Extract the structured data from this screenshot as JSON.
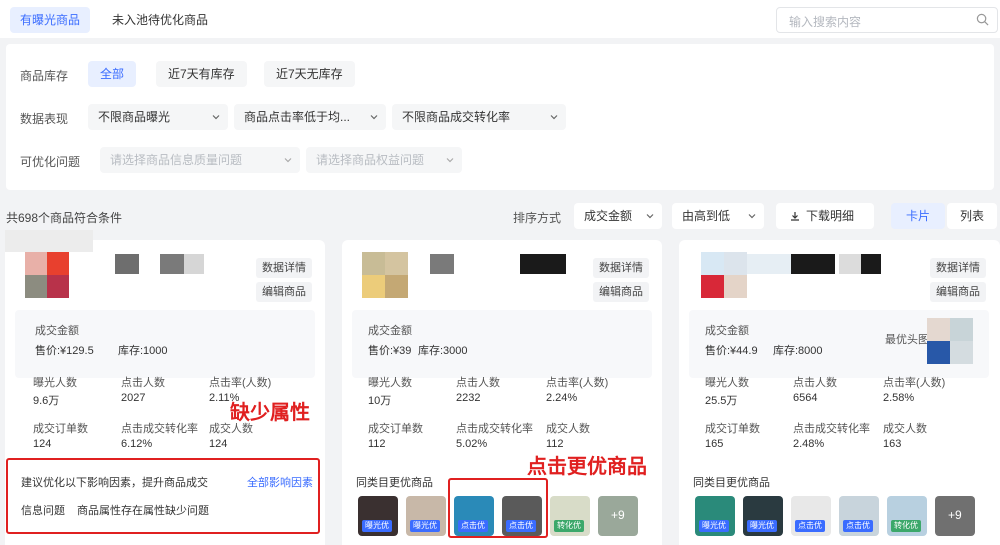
{
  "tabs": [
    {
      "label": "有曝光商品",
      "active": true
    },
    {
      "label": "未入池待优化商品",
      "active": false
    }
  ],
  "search": {
    "placeholder": "输入搜索内容",
    "icon": "search-icon"
  },
  "filters": {
    "stock": {
      "label": "商品库存",
      "options": [
        "全部",
        "近7天有库存",
        "近7天无库存"
      ],
      "selected": "全部"
    },
    "data": {
      "label": "数据表现",
      "dropdowns": [
        "不限商品曝光",
        "商品点击率低于均...",
        "不限商品成交转化率"
      ]
    },
    "issues": {
      "label": "可优化问题",
      "dropdowns": [
        "请选择商品信息质量问题",
        "请选择商品权益问题"
      ]
    }
  },
  "result_count": "共698个商品符合条件",
  "toolbar": {
    "sort_label": "排序方式",
    "sort_field": "成交金额",
    "sort_order": "由高到低",
    "download": "下载明细",
    "view_card": "卡片",
    "view_list": "列表"
  },
  "cards": [
    {
      "detail_btn": "数据详情",
      "edit_btn": "编辑商品",
      "gmv_label": "成交金额",
      "price": "售价:¥129.5",
      "stock": "库存:1000",
      "m1l": "曝光人数",
      "m1v": "9.6万",
      "m2l": "点击人数",
      "m2v": "2027",
      "m3l": "点击率(人数)",
      "m3v": "2.11%",
      "m4l": "成交订单数",
      "m4v": "124",
      "m5l": "点击成交转化率",
      "m5v": "6.12%",
      "m6l": "成交人数",
      "m6v": "124",
      "suggest": "建议优化以下影响因素，提升商品成交",
      "suggest_link": "全部影响因素",
      "issue_type": "信息问题",
      "issue_desc": "商品属性存在属性缺少问题"
    },
    {
      "detail_btn": "数据详情",
      "edit_btn": "编辑商品",
      "gmv_label": "成交金额",
      "price": "售价:¥39",
      "stock": "库存:3000",
      "m1l": "曝光人数",
      "m1v": "10万",
      "m2l": "点击人数",
      "m2v": "2232",
      "m3l": "点击率(人数)",
      "m3v": "2.24%",
      "m4l": "成交订单数",
      "m4v": "112",
      "m5l": "点击成交转化率",
      "m5v": "5.02%",
      "m6l": "成交人数",
      "m6v": "112",
      "similar": "同类目更优商品",
      "badges": [
        "曝光优",
        "曝光优",
        "点击优",
        "点击优",
        "转化优"
      ],
      "more": "+9"
    },
    {
      "detail_btn": "数据详情",
      "edit_btn": "编辑商品",
      "gmv_label": "成交金额",
      "price": "售价:¥44.9",
      "stock": "库存:8000",
      "best": "最优头图",
      "m1l": "曝光人数",
      "m1v": "25.5万",
      "m2l": "点击人数",
      "m2v": "6564",
      "m3l": "点击率(人数)",
      "m3v": "2.58%",
      "m4l": "成交订单数",
      "m4v": "165",
      "m5l": "点击成交转化率",
      "m5v": "2.48%",
      "m6l": "成交人数",
      "m6v": "163",
      "similar": "同类目更优商品",
      "badges": [
        "曝光优",
        "曝光优",
        "点击优",
        "点击优",
        "转化优"
      ],
      "more": "+9"
    }
  ],
  "annotations": {
    "missing_attr": "缺少属性",
    "click_better": "点击更优商品"
  },
  "colors": {
    "accent": "#3a6cff",
    "annotation": "#e02020"
  }
}
